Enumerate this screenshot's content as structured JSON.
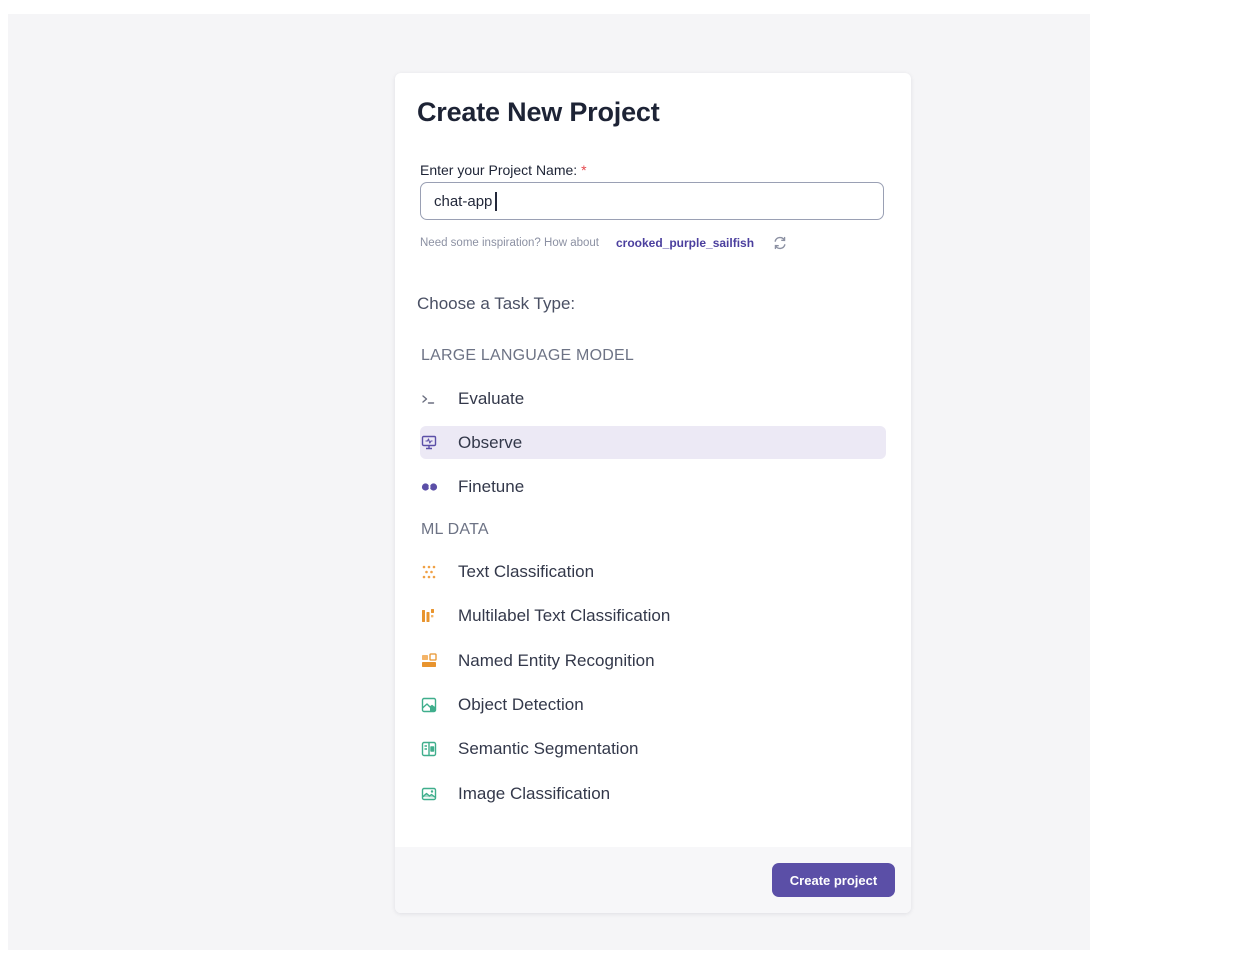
{
  "dialog": {
    "title": "Create New Project",
    "name_label": "Enter your Project Name:",
    "required_mark": "*",
    "name_value": "chat-app",
    "inspiration_text": "Need some inspiration? How about",
    "suggestion": "crooked_purple_sailfish",
    "choose_label": "Choose a Task Type:"
  },
  "sections": {
    "llm": {
      "title": "LARGE LANGUAGE MODEL",
      "items": [
        {
          "label": "Evaluate",
          "icon": "terminal-icon"
        },
        {
          "label": "Observe",
          "icon": "monitor-icon",
          "selected": true
        },
        {
          "label": "Finetune",
          "icon": "finetune-icon"
        }
      ]
    },
    "ml": {
      "title": "ML DATA",
      "items": [
        {
          "label": "Text Classification",
          "icon": "text-classification-icon"
        },
        {
          "label": "Multilabel Text Classification",
          "icon": "multilabel-icon"
        },
        {
          "label": "Named Entity Recognition",
          "icon": "ner-icon"
        },
        {
          "label": "Object Detection",
          "icon": "object-detection-icon"
        },
        {
          "label": "Semantic Segmentation",
          "icon": "segmentation-icon"
        },
        {
          "label": "Image Classification",
          "icon": "image-classification-icon"
        }
      ]
    }
  },
  "footer": {
    "create_label": "Create project"
  },
  "colors": {
    "accent": "#5b4fa7",
    "selected_bg": "#ece9f5",
    "required": "#e5484d",
    "orange": "#f0a045",
    "green": "#3fae8c"
  }
}
